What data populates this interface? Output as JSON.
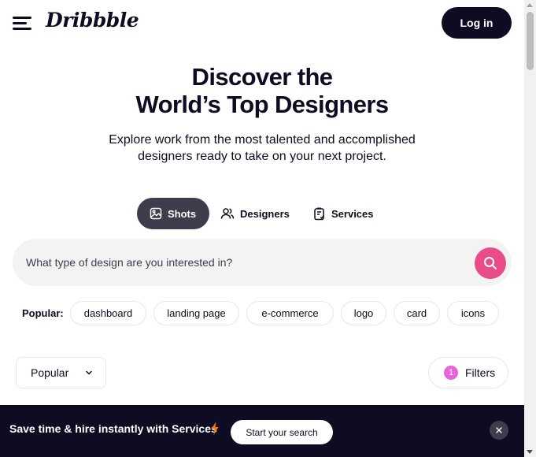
{
  "header": {
    "logo": "Dribbble",
    "login_label": "Log in"
  },
  "hero": {
    "title_line1": "Discover the",
    "title_line2": "World’s Top Designers",
    "subtitle_line1": "Explore work from the most talented and accomplished",
    "subtitle_line2": "designers ready to take on your next project."
  },
  "tabs": [
    {
      "label": "Shots",
      "icon": "image-icon",
      "active": true
    },
    {
      "label": "Designers",
      "icon": "users-icon",
      "active": false
    },
    {
      "label": "Services",
      "icon": "clipboard-icon",
      "active": false
    }
  ],
  "search": {
    "placeholder": "What type of design are you interested in?",
    "value": ""
  },
  "popular": {
    "label": "Popular:",
    "tags": [
      "dashboard",
      "landing page",
      "e-commerce",
      "logo",
      "card",
      "icons"
    ]
  },
  "sort": {
    "selected": "Popular"
  },
  "filters": {
    "label": "Filters",
    "count": "1"
  },
  "banner": {
    "text": "Save time & hire instantly with Services",
    "cta_label": "Start your search"
  },
  "colors": {
    "brand_dark": "#0d0c22",
    "accent_pink": "#ea4c89",
    "filter_badge": "#ea64d9",
    "bolt": "#f97316"
  }
}
